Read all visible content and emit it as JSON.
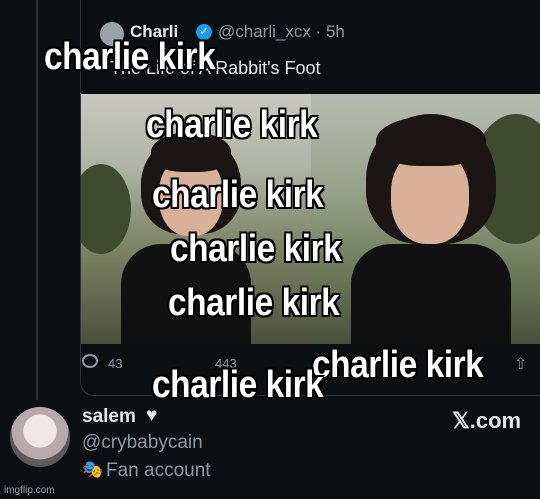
{
  "quoted_tweet": {
    "author_name": "Charli",
    "handle_time": "@charli_xcx · 5h",
    "text": "The Life of A Rabbit's Foot",
    "reply_count": "43",
    "repost_count": "443"
  },
  "attribution": {
    "name": "salem",
    "heart": "♥",
    "handle": "@crybabycain",
    "account_label": "Fan account",
    "site_logo": "𝕏.com"
  },
  "watermark": "imgflip.com",
  "captions": [
    "charlie kirk",
    "charlie kirk",
    "charlie kirk",
    "charlie kirk",
    "charlie kirk",
    "charlie kirk",
    "charlie kirk"
  ],
  "icons": {
    "reply": "reply-icon",
    "share": "share-icon",
    "verified": "verified-badge-icon",
    "mask": "mask-icon"
  }
}
